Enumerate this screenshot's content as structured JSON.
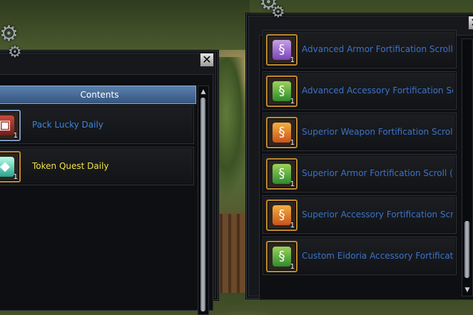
{
  "left_window": {
    "header_label": "Contents",
    "items": [
      {
        "label": "Pack Lucky Daily",
        "icon": "chest-icon",
        "qty": "1",
        "color": "#3f82d8"
      },
      {
        "label": "Token Quest Daily",
        "icon": "gem-token-icon",
        "qty": "1",
        "color": "#f1e04a"
      }
    ]
  },
  "right_window": {
    "items": [
      {
        "label": "Advanced Armor Fortification Scroll",
        "icon": "scroll-purple-icon",
        "qty": "1"
      },
      {
        "label": "Advanced Accessory Fortification Scroll",
        "icon": "scroll-green-icon",
        "qty": "1"
      },
      {
        "label": "Superior Weapon Fortification Scroll",
        "icon": "scroll-orange-icon",
        "qty": "1"
      },
      {
        "label": "Superior Armor Fortification Scroll (N",
        "icon": "scroll-green-icon",
        "qty": "1"
      },
      {
        "label": "Superior Accessory Fortification Scroll",
        "icon": "scroll-orange-icon",
        "qty": "1"
      },
      {
        "label": "Custom Eidoria Accessory Fortification",
        "icon": "scroll-green-icon",
        "qty": "1"
      }
    ]
  },
  "close_symbol": "✕",
  "scroll_up_symbol": "▲",
  "scroll_down_symbol": "▼"
}
